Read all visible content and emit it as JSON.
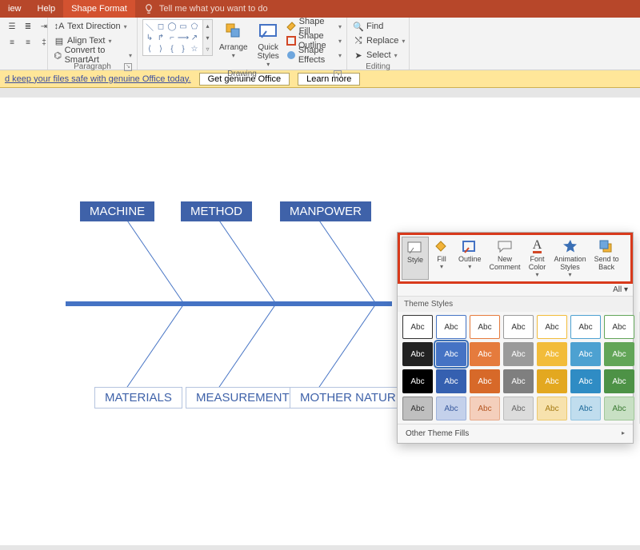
{
  "tabs": {
    "view": "iew",
    "help": "Help",
    "shapeFormat": "Shape Format"
  },
  "tellme": "Tell me what you want to do",
  "ribbon": {
    "paragraph": {
      "label": "Paragraph",
      "textDirection": "Text Direction",
      "alignText": "Align Text",
      "convert": "Convert to SmartArt"
    },
    "drawing": {
      "label": "Drawing",
      "arrange": "Arrange",
      "quickStyles": "Quick\nStyles",
      "shapeFill": "Shape Fill",
      "shapeOutline": "Shape Outline",
      "shapeEffects": "Shape Effects"
    },
    "editing": {
      "label": "Editing",
      "find": "Find",
      "replace": "Replace",
      "select": "Select"
    }
  },
  "notice": {
    "text": "d keep your files safe with genuine Office today.",
    "btn1": "Get genuine Office",
    "btn2": "Learn more"
  },
  "diagram": {
    "top": [
      "MACHINE",
      "METHOD",
      "MANPOWER"
    ],
    "bottom": [
      "MATERIALS",
      "MEASUREMENTS",
      "MOTHER NATURE"
    ]
  },
  "ctx": {
    "tools": {
      "style": "Style",
      "fill": "Fill",
      "outline": "Outline",
      "newComment": "New\nComment",
      "fontColor": "Font\nColor",
      "animStyles": "Animation\nStyles",
      "sendBack": "Send to\nBack"
    },
    "all": "All ▾",
    "section": "Theme Styles",
    "rows": [
      [
        {
          "t": "Abc",
          "bg": "#ffffff",
          "fg": "#333",
          "bd": "#333"
        },
        {
          "t": "Abc",
          "bg": "#ffffff",
          "fg": "#333",
          "bd": "#4573c4"
        },
        {
          "t": "Abc",
          "bg": "#ffffff",
          "fg": "#333",
          "bd": "#e57b3d"
        },
        {
          "t": "Abc",
          "bg": "#ffffff",
          "fg": "#333",
          "bd": "#9a9a9a"
        },
        {
          "t": "Abc",
          "bg": "#ffffff",
          "fg": "#333",
          "bd": "#f2bc3a"
        },
        {
          "t": "Abc",
          "bg": "#ffffff",
          "fg": "#333",
          "bd": "#4da1d1"
        },
        {
          "t": "Abc",
          "bg": "#ffffff",
          "fg": "#333",
          "bd": "#62a558"
        }
      ],
      [
        {
          "t": "Abc",
          "bg": "#222",
          "fg": "#fff",
          "bd": "#222"
        },
        {
          "t": "Abc",
          "bg": "#4573c4",
          "fg": "#fff",
          "bd": "#4573c4",
          "sel": true
        },
        {
          "t": "Abc",
          "bg": "#e57b3d",
          "fg": "#fff",
          "bd": "#e57b3d"
        },
        {
          "t": "Abc",
          "bg": "#9a9a9a",
          "fg": "#fff",
          "bd": "#9a9a9a"
        },
        {
          "t": "Abc",
          "bg": "#f2bc3a",
          "fg": "#fff",
          "bd": "#f2bc3a"
        },
        {
          "t": "Abc",
          "bg": "#4da1d1",
          "fg": "#fff",
          "bd": "#4da1d1"
        },
        {
          "t": "Abc",
          "bg": "#62a558",
          "fg": "#fff",
          "bd": "#62a558"
        }
      ],
      [
        {
          "t": "Abc",
          "bg": "#000",
          "fg": "#fff",
          "bd": "#000"
        },
        {
          "t": "Abc",
          "bg": "#3560b0",
          "fg": "#fff",
          "bd": "#3560b0"
        },
        {
          "t": "Abc",
          "bg": "#d76929",
          "fg": "#fff",
          "bd": "#d76929"
        },
        {
          "t": "Abc",
          "bg": "#7f7f7f",
          "fg": "#fff",
          "bd": "#7f7f7f"
        },
        {
          "t": "Abc",
          "bg": "#e3a820",
          "fg": "#fff",
          "bd": "#e3a820"
        },
        {
          "t": "Abc",
          "bg": "#2f8cc4",
          "fg": "#fff",
          "bd": "#2f8cc4"
        },
        {
          "t": "Abc",
          "bg": "#4d9246",
          "fg": "#fff",
          "bd": "#4d9246"
        }
      ],
      [
        {
          "t": "Abc",
          "bg": "#bfbfbf",
          "fg": "#333",
          "bd": "#888"
        },
        {
          "t": "Abc",
          "bg": "#c4d1eb",
          "fg": "#385a9e",
          "bd": "#9db2db"
        },
        {
          "t": "Abc",
          "bg": "#f4cfbc",
          "fg": "#b55520",
          "bd": "#e7ab8b"
        },
        {
          "t": "Abc",
          "bg": "#dcdcdc",
          "fg": "#666",
          "bd": "#bbb"
        },
        {
          "t": "Abc",
          "bg": "#f7e2ad",
          "fg": "#a57a13",
          "bd": "#ecc96f"
        },
        {
          "t": "Abc",
          "bg": "#c0ddee",
          "fg": "#1f6b9b",
          "bd": "#92c3e0"
        },
        {
          "t": "Abc",
          "bg": "#c8e0c4",
          "fg": "#3a7a32",
          "bd": "#a1c79a"
        }
      ]
    ],
    "other": "Other Theme Fills"
  }
}
